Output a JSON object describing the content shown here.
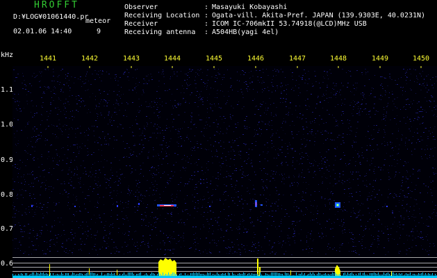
{
  "app": {
    "title": "HROFFT"
  },
  "header": {
    "file_path": "D:¥LOG¥01061440.pr",
    "mode": "meteor",
    "datetime": "02.01.06 14:40",
    "meteor_count": "9"
  },
  "info": [
    {
      "label": "Observer",
      "value": "Masayuki Kobayashi"
    },
    {
      "label": "Receiving Location",
      "value": "Ogata-vill. Akita-Pref. JAPAN (139.9303E, 40.0231N)"
    },
    {
      "label": "Receiver",
      "value": "ICOM IC-706mkII 53.74918(@LCD)MHz USB"
    },
    {
      "label": "Receiving antenna",
      "value": "A504HB(yagi 4el)"
    }
  ],
  "axis": {
    "freq_unit": "kHz",
    "freq_ticks": [
      "1441",
      "1442",
      "1443",
      "1444",
      "1445",
      "1446",
      "1447",
      "1448",
      "1449",
      "1450"
    ],
    "time_ticks": [
      "1.1",
      "1.0",
      "0.9",
      "0.8",
      "0.7",
      "0.6"
    ]
  },
  "colors": {
    "title": "#33cc33",
    "text": "#ffffff",
    "freq_labels": "#ffff33",
    "noise": "#101050",
    "trace": "#ffff00",
    "baseline": "#00ccff"
  }
}
